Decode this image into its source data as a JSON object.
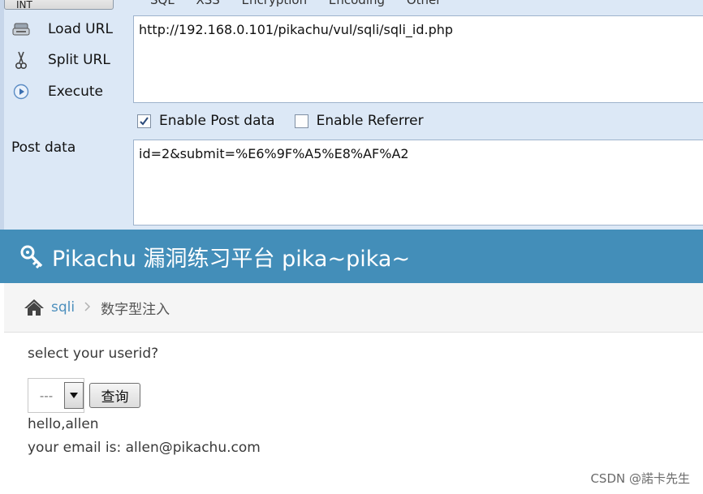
{
  "hackbar": {
    "menu_button": "INT",
    "menu_items": [
      "SQL",
      "XSS",
      "Encryption",
      "Encoding",
      "Other"
    ],
    "actions": {
      "load_url": "Load URL",
      "split_url": "Split URL",
      "execute": "Execute"
    },
    "url_value": "http://192.168.0.101/pikachu/vul/sqli/sqli_id.php",
    "options": {
      "enable_post": {
        "label": "Enable Post data",
        "checked": true
      },
      "enable_referrer": {
        "label": "Enable Referrer",
        "checked": false
      }
    },
    "post_label": "Post data",
    "post_value": "id=2&submit=%E6%9F%A5%E8%AF%A2"
  },
  "site": {
    "title": "Pikachu 漏洞练习平台 pika~pika~",
    "header_color": "#438eb9"
  },
  "breadcrumb": {
    "link": "sqli",
    "current": "数字型注入"
  },
  "form": {
    "prompt": "select your userid?",
    "select_value": "---",
    "query_button": "查询"
  },
  "result": {
    "line1": "hello,allen",
    "line2": "your email is: allen@pikachu.com"
  },
  "watermark": "CSDN @諾卡先生"
}
